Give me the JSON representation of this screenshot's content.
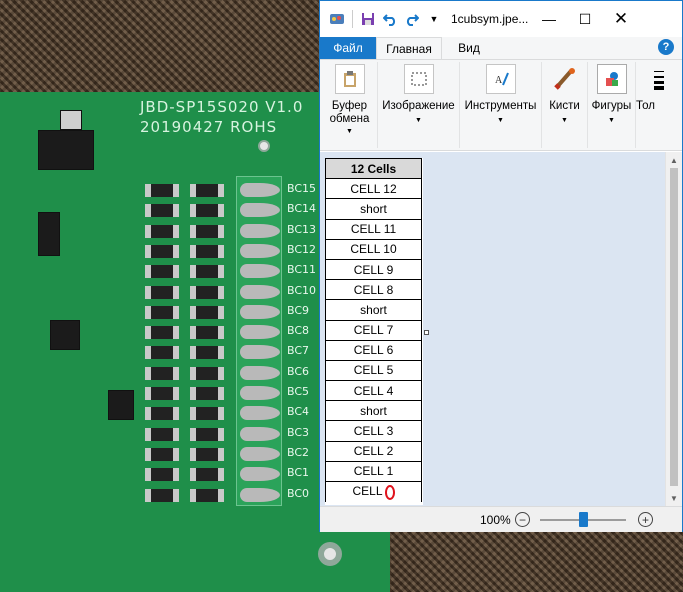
{
  "background": {
    "pcb_silkscreen": [
      "JBD-SP15S020 V1.0",
      "20190427 ROHS"
    ],
    "terminal_labels": [
      "BC15",
      "BC14",
      "BC13",
      "BC12",
      "BC11",
      "BC10",
      "BC9",
      "BC8",
      "BC7",
      "BC6",
      "BC5",
      "BC4",
      "BC3",
      "BC2",
      "BC1",
      "BC0"
    ]
  },
  "window": {
    "title": "1cubsym.jpe...",
    "title_icon": "paint-app-icon",
    "quick_access": [
      "save-icon",
      "undo-icon",
      "redo-icon",
      "customize-dropdown-icon"
    ],
    "controls": [
      "minimize-icon",
      "maximize-icon",
      "close-icon"
    ]
  },
  "tabs": {
    "file": "Файл",
    "home": "Главная",
    "view": "Вид",
    "help": "?"
  },
  "ribbon": {
    "groups": [
      {
        "label_line1": "Буфер",
        "label_line2": "обмена",
        "icon": "clipboard-icon"
      },
      {
        "label_line1": "Изображение",
        "label_line2": "",
        "icon": "select-icon"
      },
      {
        "label_line1": "Инструменты",
        "label_line2": "",
        "icon": "tools-icon"
      },
      {
        "label_line1": "Кисти",
        "label_line2": "",
        "icon": "brush-icon"
      },
      {
        "label_line1": "Фигуры",
        "label_line2": "",
        "icon": "shapes-icon"
      },
      {
        "label_line1": "Тол",
        "label_line2": "",
        "icon": "thickness-icon"
      }
    ]
  },
  "image_table": {
    "header": "12 Cells",
    "rows": [
      "CELL 12",
      "short",
      "CELL 11",
      "CELL 10",
      "CELL 9",
      "CELL 8",
      "short",
      "CELL 7",
      "CELL 6",
      "CELL 5",
      "CELL 4",
      "short",
      "CELL 3",
      "CELL 2",
      "CELL 1",
      "CELL"
    ],
    "last_row_annotation": "0"
  },
  "statusbar": {
    "zoom": "100%",
    "zoom_out": "−",
    "zoom_in": "+"
  },
  "colors": {
    "accent": "#1979ca",
    "canvas_bg": "#dbe5f2",
    "annotation_red": "#e0121c"
  }
}
